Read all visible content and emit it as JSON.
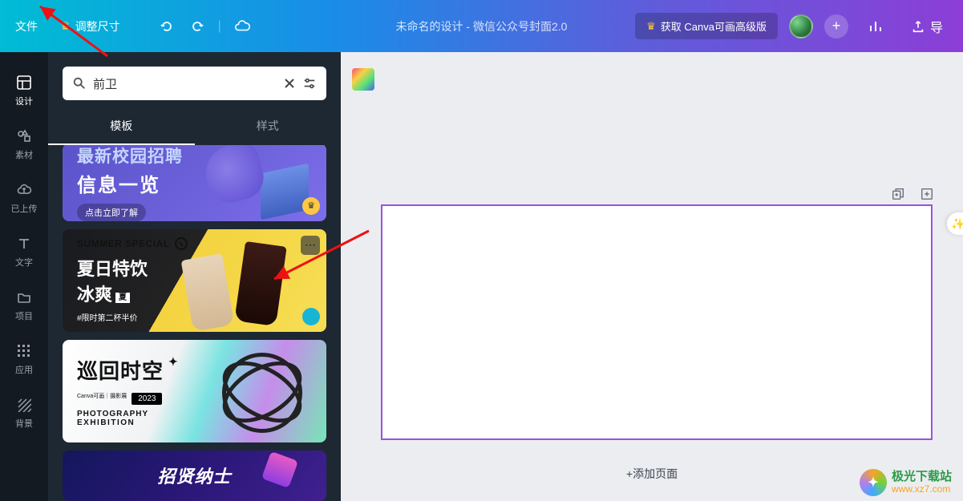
{
  "topbar": {
    "file_label": "文件",
    "resize_label": "调整尺寸",
    "doc_title": "未命名的设计 - 微信公众号封面2.0",
    "upgrade_label": "获取 Canva可画高级版",
    "plus_label": "+",
    "export_label": "导"
  },
  "leftnav": {
    "items": [
      {
        "label": "设计",
        "icon": "layout"
      },
      {
        "label": "素材",
        "icon": "shapes"
      },
      {
        "label": "已上传",
        "icon": "cloud-up"
      },
      {
        "label": "文字",
        "icon": "text"
      },
      {
        "label": "项目",
        "icon": "folder"
      },
      {
        "label": "应用",
        "icon": "grid"
      },
      {
        "label": "背景",
        "icon": "hatch"
      }
    ]
  },
  "search": {
    "value": "前卫",
    "placeholder": "搜索"
  },
  "tabs": {
    "templates": "模板",
    "styles": "样式"
  },
  "templates": [
    {
      "line1": "最新校园招聘",
      "line2": "信息一览",
      "cta": "点击立即了解"
    },
    {
      "small": "SUMMER SPECIAL",
      "line1": "夏日特饮",
      "line2": "冰爽",
      "tag": "夏",
      "sub": "#限时第二杯半价"
    },
    {
      "line1": "巡回时空",
      "year": "2023",
      "eng1": "PHOTOGRAPHY",
      "eng2": "EXHIBITION",
      "brand": "Canva可画｜摄影展"
    },
    {
      "line1": "招贤纳士"
    }
  ],
  "canvas": {
    "add_page": "+添加页面"
  },
  "watermark": {
    "title": "极光下载站",
    "url": "www.xz7.com"
  }
}
